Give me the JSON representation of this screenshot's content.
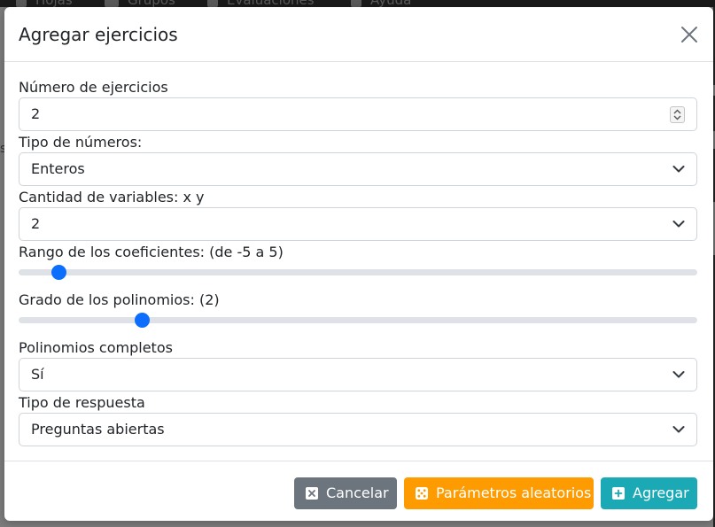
{
  "background": {
    "nav_items": [
      {
        "label": "Hojas",
        "icon": "document-icon"
      },
      {
        "label": "Grupos",
        "icon": "users-icon"
      },
      {
        "label": "Evaluaciones",
        "icon": "pencil-icon"
      },
      {
        "label": "Ayuda",
        "icon": "question-icon"
      }
    ],
    "side_letter": "s"
  },
  "modal": {
    "title": "Agregar ejercicios",
    "close_icon": "close-icon",
    "fields": {
      "num_exercises": {
        "label": "Número de ejercicios",
        "value": "2"
      },
      "number_type": {
        "label": "Tipo de números:",
        "value": "Enteros"
      },
      "num_variables": {
        "label": "Cantidad de variables: x y",
        "value": "2"
      },
      "coef_range": {
        "label": "Rango de los coeficientes: (de -5 a 5)",
        "level": 0.05
      },
      "poly_degree": {
        "label": "Grado de los polinomios: (2)",
        "level": 0.175
      },
      "complete_poly": {
        "label": "Polinomios completos",
        "value": "Sí"
      },
      "answer_type": {
        "label": "Tipo de respuesta",
        "value": "Preguntas abiertas"
      }
    },
    "footer": {
      "cancel_label": "Cancelar",
      "random_label": "Parámetros aleatorios",
      "add_label": "Agregar"
    }
  },
  "colors": {
    "accent": "#0d6efd",
    "cancel": "#6c757d",
    "random": "#fd9b00",
    "add": "#1aa9b5"
  }
}
